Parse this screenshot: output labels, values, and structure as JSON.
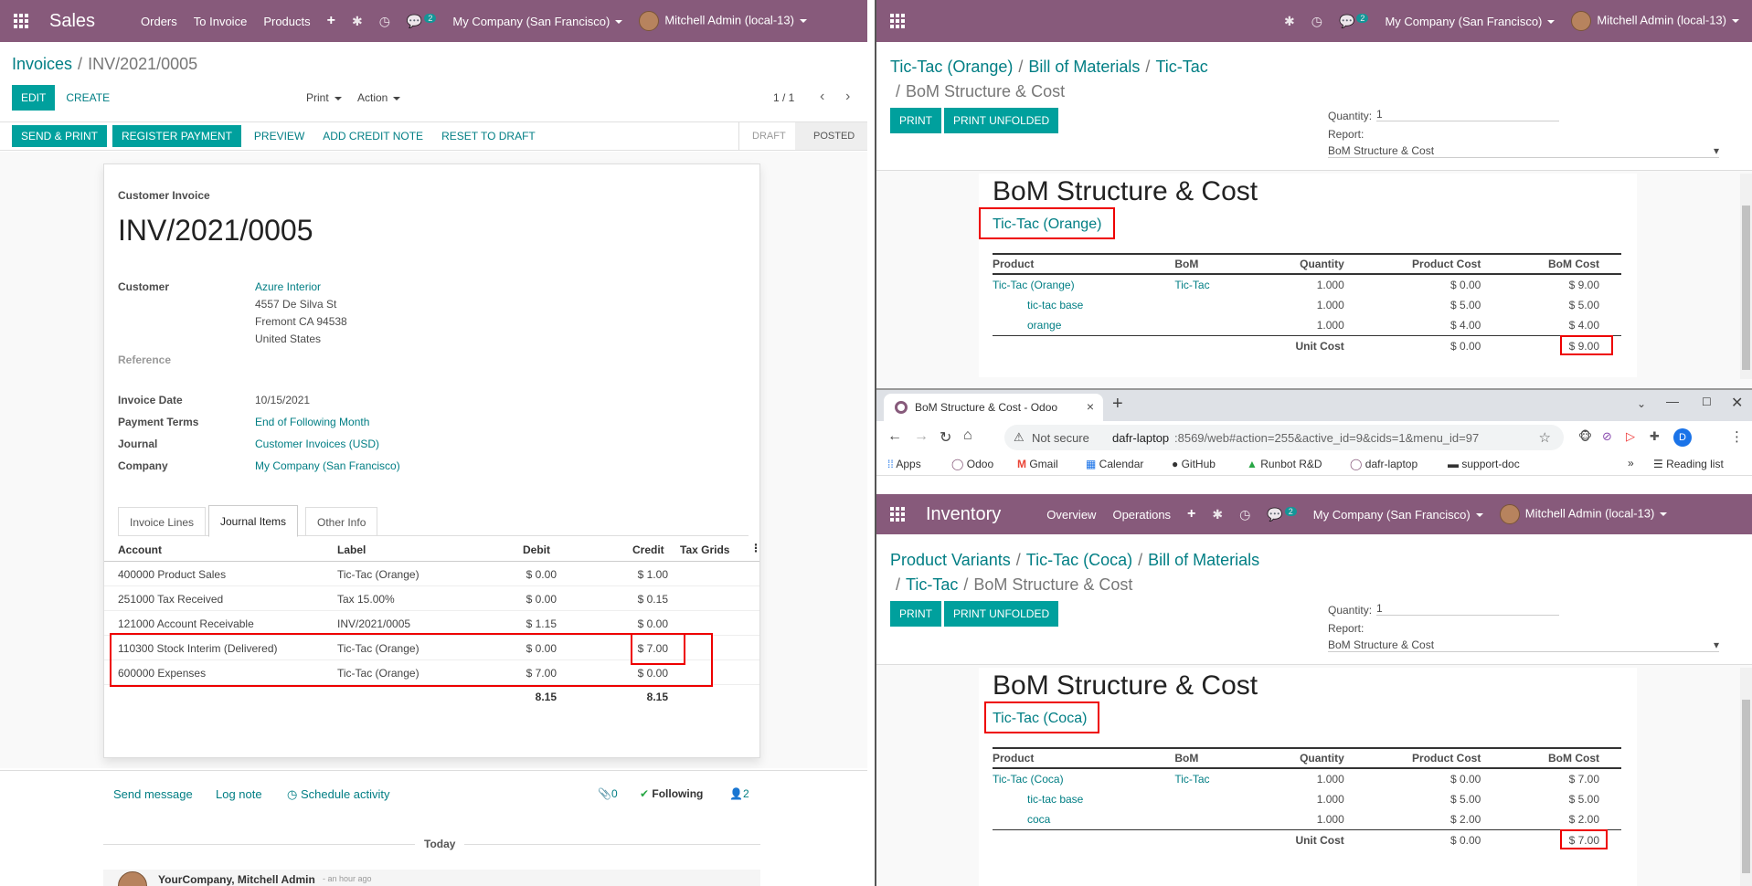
{
  "left": {
    "nav": {
      "app": "Sales",
      "menus": [
        "Orders",
        "To Invoice",
        "Products"
      ],
      "plus": "+",
      "chat_badge": "2",
      "company": "My Company (San Francisco)",
      "user": "Mitchell Admin (local-13)"
    },
    "breadcrumb": {
      "parent": "Invoices",
      "current": "INV/2021/0005"
    },
    "buttons": {
      "edit": "EDIT",
      "create": "CREATE",
      "print": "Print",
      "action": "Action",
      "pager": "1 / 1",
      "send_print": "SEND & PRINT",
      "register_payment": "REGISTER PAYMENT",
      "preview": "PREVIEW",
      "add_credit_note": "ADD CREDIT NOTE",
      "reset_to_draft": "RESET TO DRAFT",
      "status_draft": "DRAFT",
      "status_posted": "POSTED"
    },
    "invoice": {
      "type": "Customer Invoice",
      "number": "INV/2021/0005",
      "customer_label": "Customer",
      "customer_name": "Azure Interior",
      "address1": "4557 De Silva St",
      "address2": "Fremont CA 94538",
      "address3": "United States",
      "reference_label": "Reference",
      "date_label": "Invoice Date",
      "date": "10/15/2021",
      "terms_label": "Payment Terms",
      "terms": "End of Following Month",
      "journal_label": "Journal",
      "journal": "Customer Invoices (USD)",
      "company_label": "Company",
      "company": "My Company (San Francisco)"
    },
    "tabs": [
      "Invoice Lines",
      "Journal Items",
      "Other Info"
    ],
    "journal": {
      "headers": [
        "Account",
        "Label",
        "Debit",
        "Credit",
        "Tax Grids"
      ],
      "rows": [
        [
          "400000 Product Sales",
          "Tic-Tac (Orange)",
          "$ 0.00",
          "$ 1.00"
        ],
        [
          "251000 Tax Received",
          "Tax 15.00%",
          "$ 0.00",
          "$ 0.15"
        ],
        [
          "121000 Account Receivable",
          "INV/2021/0005",
          "$ 1.15",
          "$ 0.00"
        ],
        [
          "110300 Stock Interim (Delivered)",
          "Tic-Tac (Orange)",
          "$ 0.00",
          "$ 7.00"
        ],
        [
          "600000 Expenses",
          "Tic-Tac (Orange)",
          "$ 7.00",
          "$ 0.00"
        ]
      ],
      "total_debit": "8.15",
      "total_credit": "8.15"
    },
    "chatter": {
      "send_message": "Send message",
      "log_note": "Log note",
      "schedule": "Schedule activity",
      "attachments": "0",
      "following": "Following",
      "followers": "2",
      "today": "Today",
      "author": "YourCompany, Mitchell Admin",
      "time": "- an hour ago"
    }
  },
  "right_top": {
    "nav": {
      "chat_badge": "2",
      "company": "My Company (San Francisco)",
      "user": "Mitchell Admin (local-13)"
    },
    "breadcrumb": [
      "Tic-Tac (Orange)",
      "Bill of Materials",
      "Tic-Tac",
      "BoM Structure & Cost"
    ],
    "print": "PRINT",
    "print_unfolded": "PRINT UNFOLDED",
    "quantity_label": "Quantity:",
    "quantity": "1",
    "report_label": "Report:",
    "report": "BoM Structure & Cost",
    "title": "BoM Structure & Cost",
    "product": "Tic-Tac (Orange)",
    "headers": [
      "Product",
      "BoM",
      "Quantity",
      "Product Cost",
      "BoM Cost"
    ],
    "rows": [
      [
        "Tic-Tac (Orange)",
        "Tic-Tac",
        "1.000",
        "$ 0.00",
        "$ 9.00"
      ],
      [
        "tic-tac base",
        "",
        "1.000",
        "$ 5.00",
        "$ 5.00"
      ],
      [
        "orange",
        "",
        "1.000",
        "$ 4.00",
        "$ 4.00"
      ]
    ],
    "unit_cost_label": "Unit Cost",
    "unit_product_cost": "$ 0.00",
    "unit_bom_cost": "$ 9.00"
  },
  "browser": {
    "tab_title": "BoM Structure & Cost - Odoo",
    "not_secure": "Not secure",
    "url_host": "dafr-laptop",
    "url_rest": ":8569/web#action=255&active_id=9&cids=1&menu_id=97",
    "profile": "D",
    "bookmarks": [
      "Apps",
      "Odoo",
      "Gmail",
      "Calendar",
      "GitHub",
      "Runbot R&D",
      "dafr-laptop",
      "support-doc"
    ],
    "reading_list": "Reading list"
  },
  "right_bottom": {
    "nav": {
      "app": "Inventory",
      "menus": [
        "Overview",
        "Operations"
      ],
      "plus": "+",
      "chat_badge": "2",
      "company": "My Company (San Francisco)",
      "user": "Mitchell Admin (local-13)"
    },
    "breadcrumb": [
      "Product Variants",
      "Tic-Tac (Coca)",
      "Bill of Materials",
      "Tic-Tac",
      "BoM Structure & Cost"
    ],
    "print": "PRINT",
    "print_unfolded": "PRINT UNFOLDED",
    "quantity_label": "Quantity:",
    "quantity": "1",
    "report_label": "Report:",
    "report": "BoM Structure & Cost",
    "title": "BoM Structure & Cost",
    "product": "Tic-Tac (Coca)",
    "headers": [
      "Product",
      "BoM",
      "Quantity",
      "Product Cost",
      "BoM Cost"
    ],
    "rows": [
      [
        "Tic-Tac (Coca)",
        "Tic-Tac",
        "1.000",
        "$ 0.00",
        "$ 7.00"
      ],
      [
        "tic-tac base",
        "",
        "1.000",
        "$ 5.00",
        "$ 5.00"
      ],
      [
        "coca",
        "",
        "1.000",
        "$ 2.00",
        "$ 2.00"
      ]
    ],
    "unit_cost_label": "Unit Cost",
    "unit_product_cost": "$ 0.00",
    "unit_bom_cost": "$ 7.00"
  },
  "colors": {
    "odoo_purple": "#875a7b",
    "teal": "#00a09d",
    "link": "#017e84",
    "highlight": "#e00000"
  }
}
